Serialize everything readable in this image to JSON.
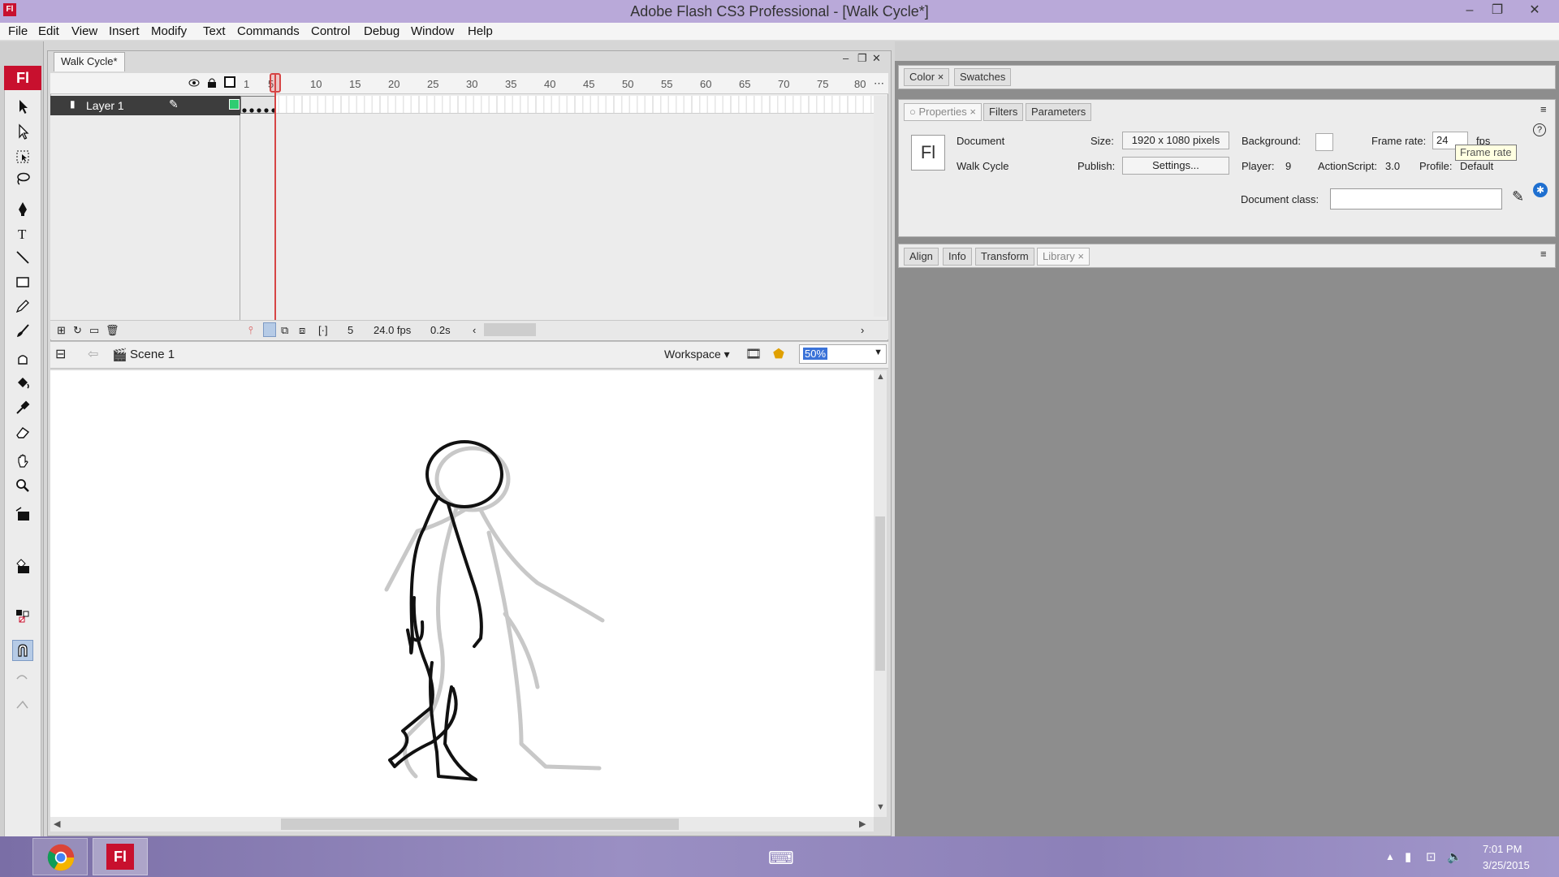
{
  "window": {
    "app_icon": "Fl",
    "title": "Adobe Flash CS3 Professional - [Walk Cycle*]",
    "minimize": "–",
    "restore": "❐",
    "close": "✕"
  },
  "menu": [
    "File",
    "Edit",
    "View",
    "Insert",
    "Modify",
    "Text",
    "Commands",
    "Control",
    "Debug",
    "Window",
    "Help"
  ],
  "toolbox": {
    "logo": "Fl",
    "tools": [
      "selection-tool",
      "subselection-tool",
      "free-transform-tool",
      "lasso-tool",
      "pen-tool",
      "text-tool",
      "line-tool",
      "rectangle-tool",
      "pencil-tool",
      "brush-tool",
      "ink-bottle-tool",
      "paint-bucket-tool",
      "eyedropper-tool",
      "eraser-tool",
      "hand-tool",
      "zoom-tool"
    ]
  },
  "document": {
    "tab_label": "Walk Cycle*"
  },
  "timeline": {
    "layer_name": "Layer 1",
    "ticks": [
      "1",
      "5",
      "10",
      "15",
      "20",
      "25",
      "30",
      "35",
      "40",
      "45",
      "50",
      "55",
      "60",
      "65",
      "70",
      "75",
      "80"
    ],
    "current_frame": "5",
    "fps": "24.0 fps",
    "elapsed": "0.2s"
  },
  "editbar": {
    "scene": "Scene 1",
    "workspace": "Workspace",
    "zoom": "50%"
  },
  "panels": {
    "color_tabs": [
      "Color",
      "Swatches"
    ],
    "properties_tabs": [
      "Properties",
      "Filters",
      "Parameters"
    ],
    "library_tabs": [
      "Align",
      "Info",
      "Transform",
      "Library"
    ]
  },
  "properties": {
    "doc_type": "Document",
    "doc_name": "Walk Cycle",
    "thumb": "Fl",
    "size_label": "Size:",
    "size_value": "1920 x 1080 pixels",
    "publish_label": "Publish:",
    "settings_button": "Settings...",
    "background_label": "Background:",
    "frame_rate_label": "Frame rate:",
    "frame_rate_value": "24",
    "fps_unit": "fps",
    "player_label": "Player:",
    "player_value": "9",
    "actionscript_label": "ActionScript:",
    "actionscript_value": "3.0",
    "profile_label": "Profile:",
    "profile_value": "Default",
    "document_class_label": "Document class:",
    "document_class_value": "",
    "tooltip": "Frame rate"
  },
  "taskbar": {
    "apps": [
      "chrome-icon",
      "flash-icon"
    ],
    "flash_label": "Fl",
    "time": "7:01 PM",
    "date": "3/25/2015"
  },
  "colors": {
    "titlebar": "#b9a9d9",
    "flash_red": "#c8102e",
    "playhead": "#d64545",
    "selection_blue": "#3a72d8"
  }
}
